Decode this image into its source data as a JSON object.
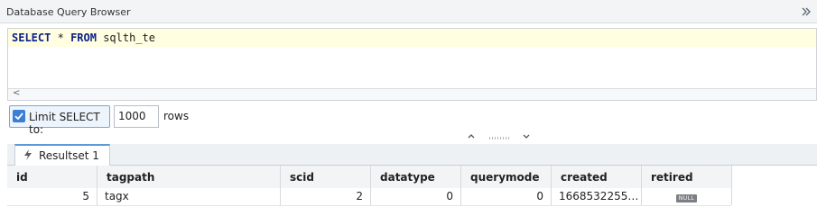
{
  "window": {
    "title": "Database Query Browser"
  },
  "editor": {
    "query_keyword_select": "SELECT",
    "query_star": "*",
    "query_keyword_from": "FROM",
    "query_table": "sqlth_te"
  },
  "limit": {
    "checked": true,
    "label": "Limit SELECT to:",
    "value": "1000",
    "unit_label": "rows"
  },
  "results": {
    "tab_label": "Resultset 1",
    "columns": [
      "id",
      "tagpath",
      "scid",
      "datatype",
      "querymode",
      "created",
      "retired"
    ],
    "rows": [
      [
        "5",
        "tagx",
        "2",
        "0",
        "0",
        "1668532255…",
        "NULL"
      ]
    ]
  },
  "colors": {
    "accent": "#3a7fd5",
    "editor_line_highlight": "#fffee0",
    "keyword": "#0b1f8a"
  }
}
